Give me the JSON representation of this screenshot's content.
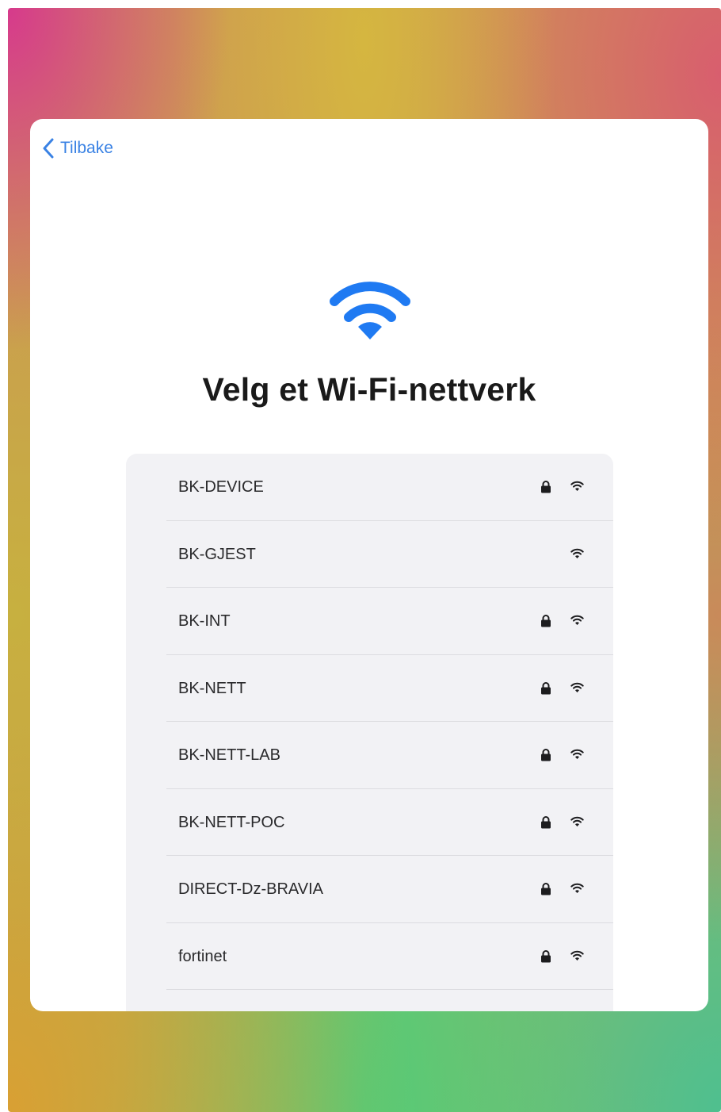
{
  "header": {
    "back_label": "Tilbake"
  },
  "title": "Velg et Wi-Fi-nettverk",
  "colors": {
    "accent": "#1f7af2",
    "back_link": "#3a82e4",
    "text": "#1a1a1a",
    "list_background": "#f2f2f5"
  },
  "icons": {
    "hero": "wifi-icon",
    "back": "chevron-left-icon",
    "secured": "lock-icon",
    "signal": "wifi-icon"
  },
  "networks": [
    {
      "name": "BK-DEVICE",
      "secured": true
    },
    {
      "name": "BK-GJEST",
      "secured": false
    },
    {
      "name": "BK-INT",
      "secured": true
    },
    {
      "name": "BK-NETT",
      "secured": true
    },
    {
      "name": "BK-NETT-LAB",
      "secured": true
    },
    {
      "name": "BK-NETT-POC",
      "secured": true
    },
    {
      "name": "DIRECT-Dz-BRAVIA",
      "secured": true
    },
    {
      "name": "fortinet",
      "secured": true
    }
  ]
}
